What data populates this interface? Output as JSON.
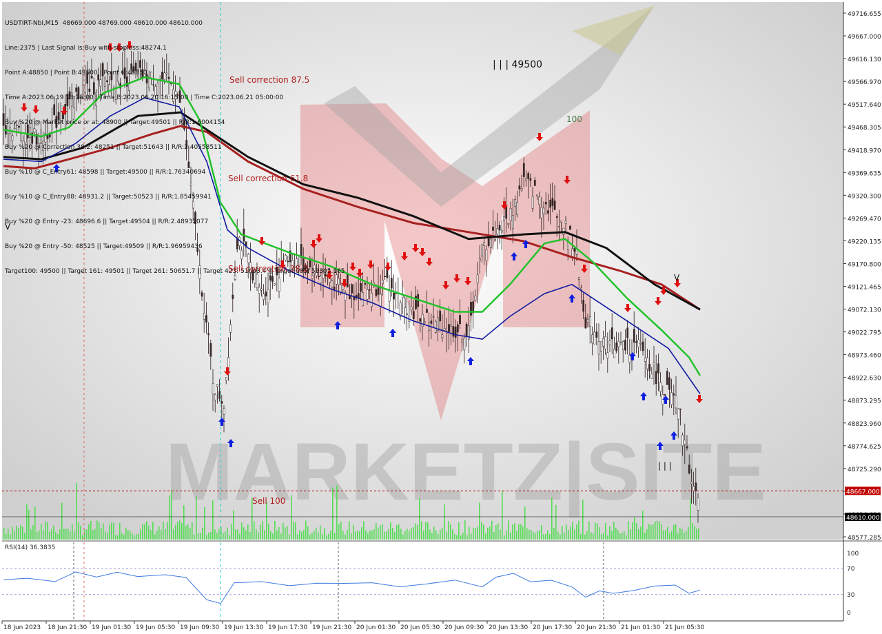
{
  "header": {
    "title": "USDTIRT-Nbi,M15",
    "ohlc": "48669.000 48769.000 48610.000 48610.000",
    "lines": [
      "Line:2375 | Last Signal is:Buy with stoploss:48274.1",
      "Point A:48850 | Point B:49500 | Point C:48850",
      "Time A:2023.06.19 13:15:00 | Time B:2023.06.20 16:15:00 | Time C:2023.06.21 05:00:00",
      "Buy %20 @ Market price or at: 48900 || Target:49501 || R/R:1.6004154",
      "Buy %20 @ Correction 38.2: 48251 || Target:51643 || R/R:2.40558511",
      "Buy %10 @ C_Entry61: 48598 || Target:49500 || R/R:1.76340694",
      "Buy %10 @ C_Entry88: 48931.2 || Target:50523 || R/R:1.85459941",
      "Buy %20 @ Entry -23: 48696.6 || Target:49504 || R/R:2.48932077",
      "Buy %20 @ Entry -50: 48525 || Target:49509 || R/R:1.96959436",
      "Target100: 49500 || Target 161: 49501 || Target 261: 50651.7 || Target 423: 51603.4 || Target 685: 53305.165"
    ]
  },
  "annotations": {
    "sell_875": "Sell correction 87.5",
    "sell_618": "Sell correction 61.8",
    "sell_382": "Sell correction 38.2",
    "sell_100": "Sell 100",
    "level_49500": "| | | 49500",
    "level_100": "100",
    "bars_mark": "| | |",
    "v_left": "V",
    "v_right": "V",
    "watermark": "MARKETZ|SITE"
  },
  "price_axis": {
    "ticks": [
      "49716.655",
      "49667.000",
      "49616.130",
      "49566.970",
      "49517.640",
      "49468.305",
      "49418.970",
      "49369.635",
      "49320.300",
      "49269.470",
      "49220.135",
      "49170.800",
      "49121.465",
      "49072.130",
      "49022.795",
      "48973.460",
      "48922.630",
      "48873.295",
      "48823.960",
      "48774.625",
      "48725.290",
      "48675.955",
      "48626.620",
      "48577.285"
    ],
    "red_label": "48667.000",
    "black_label": "48610.000"
  },
  "rsi": {
    "label": "RSI(14) 36.3835",
    "ticks": [
      "100",
      "70",
      "30",
      "0"
    ]
  },
  "time_axis": [
    "18 Jun 2023",
    "18 Jun 21:30",
    "19 Jun 01:30",
    "19 Jun 05:30",
    "19 Jun 09:30",
    "19 Jun 13:30",
    "19 Jun 17:30",
    "19 Jun 21:30",
    "20 Jun 01:30",
    "20 Jun 05:30",
    "20 Jun 09:30",
    "20 Jun 13:30",
    "20 Jun 17:30",
    "20 Jun 21:30",
    "21 Jun 01:30",
    "21 Jun 05:30"
  ],
  "colors": {
    "green_ma": "#22c22a",
    "blue_ma": "#101aa0",
    "black_ma": "#111111",
    "darkred_ma": "#a82020",
    "red_level": "#c00000",
    "sell_arrow": "#e01010",
    "buy_arrow": "#1020e0",
    "volume": "#55dd55",
    "rsi_line": "#3a78e0"
  },
  "chart_data": {
    "type": "candlestick",
    "title": "USDTIRT-Nbi,M15",
    "ylim": [
      48560,
      49740
    ],
    "red_level": 48667,
    "last_price": 48610,
    "key_points": [
      {
        "label": "Point A",
        "value": 48850
      },
      {
        "label": "Point B",
        "value": 49500
      },
      {
        "label": "Point C",
        "value": 48850
      }
    ],
    "rsi_last": 36.3835,
    "rsi_levels": [
      70,
      30
    ]
  }
}
